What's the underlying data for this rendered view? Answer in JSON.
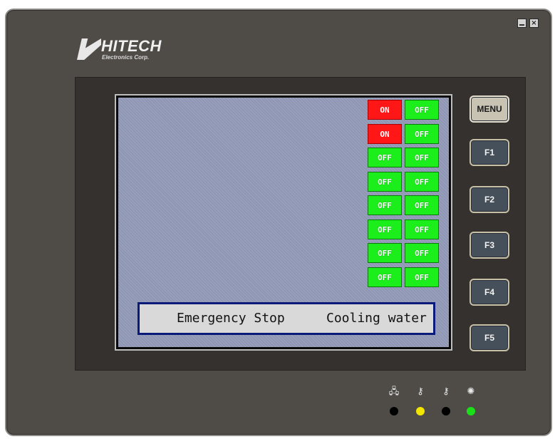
{
  "device": {
    "brand": "HITECH",
    "brand_sub": "Electronics Corp."
  },
  "window_controls": {
    "minimize_icon": "minimize-icon",
    "close_symbol": "×"
  },
  "screen": {
    "rows": [
      {
        "left": "ON",
        "right": "OFF"
      },
      {
        "left": "ON",
        "right": "OFF"
      },
      {
        "left": "OFF",
        "right": "OFF"
      },
      {
        "left": "OFF",
        "right": "OFF"
      },
      {
        "left": "OFF",
        "right": "OFF"
      },
      {
        "left": "OFF",
        "right": "OFF"
      },
      {
        "left": "OFF",
        "right": "OFF"
      },
      {
        "left": "OFF",
        "right": "OFF"
      }
    ],
    "message_left": "Emergency Stop",
    "message_right": "Cooling water"
  },
  "function_keys": [
    {
      "label": "MENU"
    },
    {
      "label": "F1"
    },
    {
      "label": "F2"
    },
    {
      "label": "F3"
    },
    {
      "label": "F4"
    },
    {
      "label": "F5"
    }
  ],
  "indicators": [
    {
      "icon": "network-icon",
      "glyph": "🖧",
      "led_color": "#000000"
    },
    {
      "icon": "key-icon",
      "glyph": "⚷",
      "led_color": "#f2e600"
    },
    {
      "icon": "key-icon",
      "glyph": "⚷",
      "led_color": "#000000"
    },
    {
      "icon": "light-icon",
      "glyph": "✺",
      "led_color": "#19e019"
    }
  ],
  "colors": {
    "on": "#ff1616",
    "off": "#1cee1c",
    "message_border": "#0a1a78"
  }
}
